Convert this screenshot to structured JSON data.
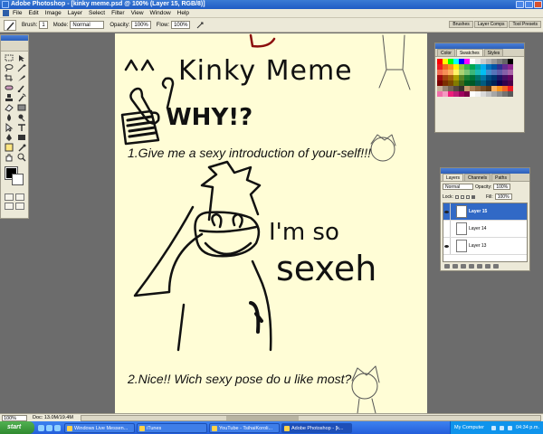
{
  "window": {
    "title": "Adobe Photoshop - [kinky meme.psd @ 100% (Layer 15, RGB/8)]"
  },
  "menu": [
    "File",
    "Edit",
    "Image",
    "Layer",
    "Select",
    "Filter",
    "View",
    "Window",
    "Help"
  ],
  "options": {
    "brush_label": "Brush:",
    "brush_size": "1",
    "mode_label": "Mode:",
    "mode_value": "Normal",
    "opacity_label": "Opacity:",
    "opacity_value": "100%",
    "flow_label": "Flow:",
    "flow_value": "100%",
    "well_tabs": [
      "Brushes",
      "Layer Comps",
      "Tool Presets"
    ]
  },
  "toolbox": {
    "tools": [
      "marquee",
      "move",
      "lasso",
      "magic-wand",
      "crop",
      "slice",
      "healing",
      "brush",
      "stamp",
      "history-brush",
      "eraser",
      "gradient",
      "blur",
      "dodge",
      "path-select",
      "type",
      "pen",
      "shape",
      "notes",
      "eyedropper",
      "hand",
      "zoom"
    ]
  },
  "swatches_panel": {
    "tabs": [
      "Color",
      "Swatches",
      "Styles"
    ],
    "active_tab": "Swatches",
    "colors": [
      "#ff0000",
      "#ffff00",
      "#00ff00",
      "#00ffff",
      "#0000ff",
      "#ff00ff",
      "#ffffff",
      "#e6e6e6",
      "#cccccc",
      "#b3b3b3",
      "#999999",
      "#808080",
      "#666666",
      "#000000",
      "#ed1c24",
      "#f26522",
      "#f7941d",
      "#fff200",
      "#8dc63f",
      "#39b54a",
      "#00a651",
      "#00a99d",
      "#00aeef",
      "#0072bc",
      "#0054a6",
      "#2e3192",
      "#662d91",
      "#92278f",
      "#f26c4f",
      "#f68e56",
      "#fbaf5d",
      "#fff568",
      "#acd373",
      "#7cc576",
      "#3cb878",
      "#1cbbb4",
      "#00bff3",
      "#448ccb",
      "#5674b9",
      "#605ca8",
      "#8560a8",
      "#a864a8",
      "#9e0b0f",
      "#a0410d",
      "#a36209",
      "#aba000",
      "#598527",
      "#197b30",
      "#007236",
      "#00746b",
      "#0076a3",
      "#004a80",
      "#003471",
      "#1b1464",
      "#440e62",
      "#630460",
      "#790000",
      "#7b2e00",
      "#7d4900",
      "#827b00",
      "#406618",
      "#005e20",
      "#005826",
      "#005952",
      "#005b7f",
      "#003663",
      "#002157",
      "#0d004c",
      "#32004b",
      "#4b0049",
      "#c7b299",
      "#998675",
      "#736357",
      "#534741",
      "#37302d",
      "#c69c6d",
      "#a67c52",
      "#8c6239",
      "#754c24",
      "#603913",
      "#fbaf5d",
      "#f7941d",
      "#f26522",
      "#ed1c24",
      "#f06eaa",
      "#f49ac1",
      "#ee1d7a",
      "#bd1e77",
      "#9e005d",
      "#7a0045",
      "#ffffff",
      "#f2f2f2",
      "#d9d9d9",
      "#bfbfbf",
      "#a6a6a6",
      "#8c8c8c",
      "#737373",
      "#595959"
    ]
  },
  "layers_panel": {
    "tabs": [
      "Layers",
      "Channels",
      "Paths"
    ],
    "blend_mode": "Normal",
    "opacity_label": "Opacity:",
    "opacity_value": "100%",
    "lock_label": "Lock:",
    "fill_label": "Fill:",
    "fill_value": "100%",
    "layers": [
      {
        "name": "Layer 15",
        "selected": true,
        "visible": true
      },
      {
        "name": "Layer 14",
        "selected": false,
        "visible": false
      },
      {
        "name": "Layer 13",
        "selected": false,
        "visible": true
      }
    ]
  },
  "document": {
    "title_text": "Kinky Meme",
    "why_text": "WHY!?",
    "question1": "1.Give me a sexy introduction of your-self!!!",
    "answer_line1": "I'm so",
    "answer_line2": "sexeh",
    "question2": "2.Nice!! Wich sexy pose do u like most?"
  },
  "status": {
    "zoom": "100%",
    "doc_info": "Doc: 13.0M/19.4M"
  },
  "taskbar": {
    "start_label": "start",
    "tasks": [
      {
        "label": "Windows Live Messen...",
        "active": false
      },
      {
        "label": "iTunes",
        "active": false
      },
      {
        "label": "YouTube - TsihaiKoroli...",
        "active": false
      },
      {
        "label": "Adobe Photoshop - [k...",
        "active": true
      }
    ],
    "tray_label": "My Computer",
    "clock": "04:34 p.m."
  }
}
